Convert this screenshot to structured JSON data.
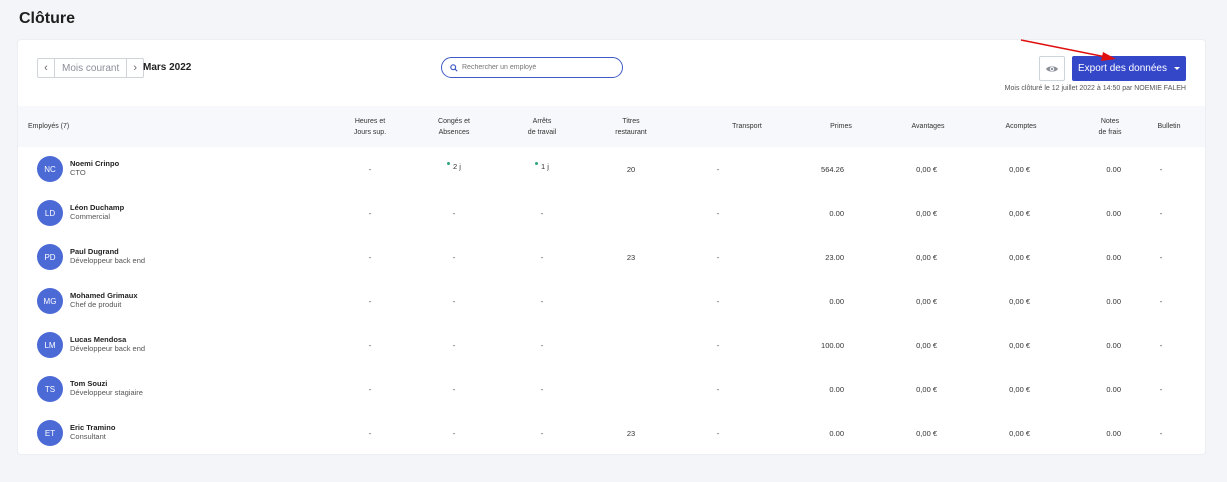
{
  "page": {
    "title": "Clôture"
  },
  "toolbar": {
    "prev_icon": "chevron-left-icon",
    "next_icon": "chevron-right-icon",
    "prev_label": "‹",
    "next_label": "›",
    "current_label": "Mois courant",
    "month": "Mars 2022",
    "search_placeholder": "Rechercher un employé",
    "export_label": "Export des données",
    "closed_info": "Mois clôturé le 12 juillet 2022 à 14:50 par NOEMIE FALEH"
  },
  "table": {
    "headers": {
      "employees": "Employés (7)",
      "overtime_1": "Heures et",
      "overtime_2": "Jours sup.",
      "leave_1": "Congés et",
      "leave_2": "Absences",
      "sick_1": "Arrêts",
      "sick_2": "de travail",
      "meal_1": "Titres",
      "meal_2": "restaurant",
      "transport": "Transport",
      "bonuses": "Primes",
      "benefits": "Avantages",
      "advances": "Acomptes",
      "expenses_1": "Notes",
      "expenses_2": "de frais",
      "payslip": "Bulletin"
    },
    "rows": [
      {
        "initials": "NC",
        "name": "Noemi Crinpo",
        "role": "CTO",
        "overtime": "-",
        "leave": "2 j",
        "sick": "1 j",
        "meal": "20",
        "transport": "-",
        "bonuses": "564.26",
        "benefits": "0,00 €",
        "advances": "0,00 €",
        "expenses": "0.00",
        "payslip": "-"
      },
      {
        "initials": "LD",
        "name": "Léon Duchamp",
        "role": "Commercial",
        "overtime": "-",
        "leave": "-",
        "sick": "-",
        "meal": "",
        "transport": "-",
        "bonuses": "0.00",
        "benefits": "0,00 €",
        "advances": "0,00 €",
        "expenses": "0.00",
        "payslip": "-"
      },
      {
        "initials": "PD",
        "name": "Paul Dugrand",
        "role": "Développeur back end",
        "overtime": "-",
        "leave": "-",
        "sick": "-",
        "meal": "23",
        "transport": "-",
        "bonuses": "23.00",
        "benefits": "0,00 €",
        "advances": "0,00 €",
        "expenses": "0.00",
        "payslip": "-"
      },
      {
        "initials": "MG",
        "name": "Mohamed Grimaux",
        "role": "Chef de produit",
        "overtime": "-",
        "leave": "-",
        "sick": "-",
        "meal": "",
        "transport": "-",
        "bonuses": "0.00",
        "benefits": "0,00 €",
        "advances": "0,00 €",
        "expenses": "0.00",
        "payslip": "-"
      },
      {
        "initials": "LM",
        "name": "Lucas Mendosa",
        "role": "Développeur back end",
        "overtime": "-",
        "leave": "-",
        "sick": "-",
        "meal": "",
        "transport": "-",
        "bonuses": "100.00",
        "benefits": "0,00 €",
        "advances": "0,00 €",
        "expenses": "0.00",
        "payslip": "-"
      },
      {
        "initials": "TS",
        "name": "Tom Souzi",
        "role": "Développeur stagiaire",
        "overtime": "-",
        "leave": "-",
        "sick": "-",
        "meal": "",
        "transport": "-",
        "bonuses": "0.00",
        "benefits": "0,00 €",
        "advances": "0,00 €",
        "expenses": "0.00",
        "payslip": "-"
      },
      {
        "initials": "ET",
        "name": "Eric Tramino",
        "role": "Consultant",
        "overtime": "-",
        "leave": "-",
        "sick": "-",
        "meal": "23",
        "transport": "-",
        "bonuses": "0.00",
        "benefits": "0,00 €",
        "advances": "0,00 €",
        "expenses": "0.00",
        "payslip": "-"
      }
    ]
  },
  "colors": {
    "accent": "#3447c9",
    "avatar": "#4b6ad6",
    "status_dot": "#2aa87a",
    "annotation_arrow": "#e01010"
  }
}
